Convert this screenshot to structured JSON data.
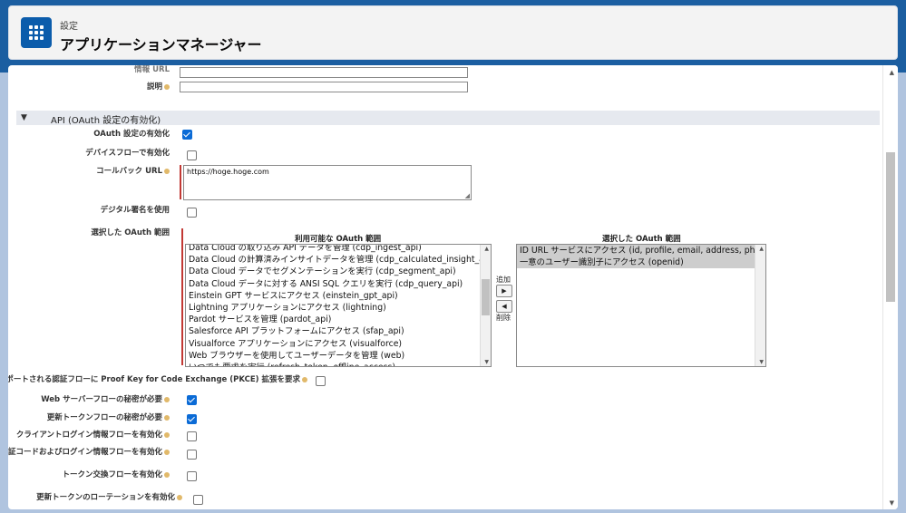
{
  "header": {
    "breadcrumb": "設定",
    "title": "アプリケーションマネージャー"
  },
  "form": {
    "info_url_label": "情報 URL",
    "description_label": "説明",
    "api_section_title": "API (OAuth 設定の有効化)",
    "enable_oauth_label": "OAuth 設定の有効化",
    "enable_device_flow_label": "デバイスフローで有効化",
    "callback_url_label": "コールバック URL",
    "callback_url_value": "https://hoge.hoge.com",
    "digital_signature_label": "デジタル署名を使用",
    "selected_scopes_label": "選択した OAuth 範囲",
    "available_scopes_title": "利用可能な OAuth 範囲",
    "selected_scopes_title": "選択した OAuth 範囲",
    "add_label": "追加",
    "remove_label": "削除",
    "available_scopes": [
      "Data Cloud の取り込み API データを管理 (cdp_ingest_api)",
      "Data Cloud の計算済みインサイトデータを管理 (cdp_calculated_insight_api)",
      "Data Cloud データでセグメンテーションを実行 (cdp_segment_api)",
      "Data Cloud データに対する ANSI SQL クエリを実行 (cdp_query_api)",
      "Einstein GPT サービスにアクセス (einstein_gpt_api)",
      "Lightning アプリケーションにアクセス (lightning)",
      "Pardot サービスを管理 (pardot_api)",
      "Salesforce API プラットフォームにアクセス (sfap_api)",
      "Visualforce アプリケーションにアクセス (visualforce)",
      "Web ブラウザーを使用してユーザーデータを管理 (web)",
      "いつでも要求を実行 (refresh_token, offline_access)"
    ],
    "selected_scopes": [
      "ID URL サービスにアクセス (id, profile, email, address, phone)",
      "一意のユーザー識別子にアクセス (openid)"
    ],
    "pkce_label": "サポートされる認証フローに Proof Key for Code Exchange (PKCE) 拡張を要求",
    "web_server_secret_label": "Web サーバーフローの秘密が必要",
    "refresh_secret_label": "更新トークンフローの秘密が必要",
    "client_credentials_label": "クライアントログイン情報フローを有効化",
    "auth_code_label": "認証コードおよびログイン情報フローを有効化",
    "token_exchange_label": "トークン交換フローを有効化",
    "refresh_rotation_label": "更新トークンのローテーションを有効化",
    "checked": {
      "enable_oauth": true,
      "device_flow": false,
      "digital_signature": false,
      "pkce": false,
      "web_server_secret": true,
      "refresh_secret": true,
      "client_credentials": false,
      "auth_code": false,
      "token_exchange": false,
      "refresh_rotation": false
    }
  }
}
